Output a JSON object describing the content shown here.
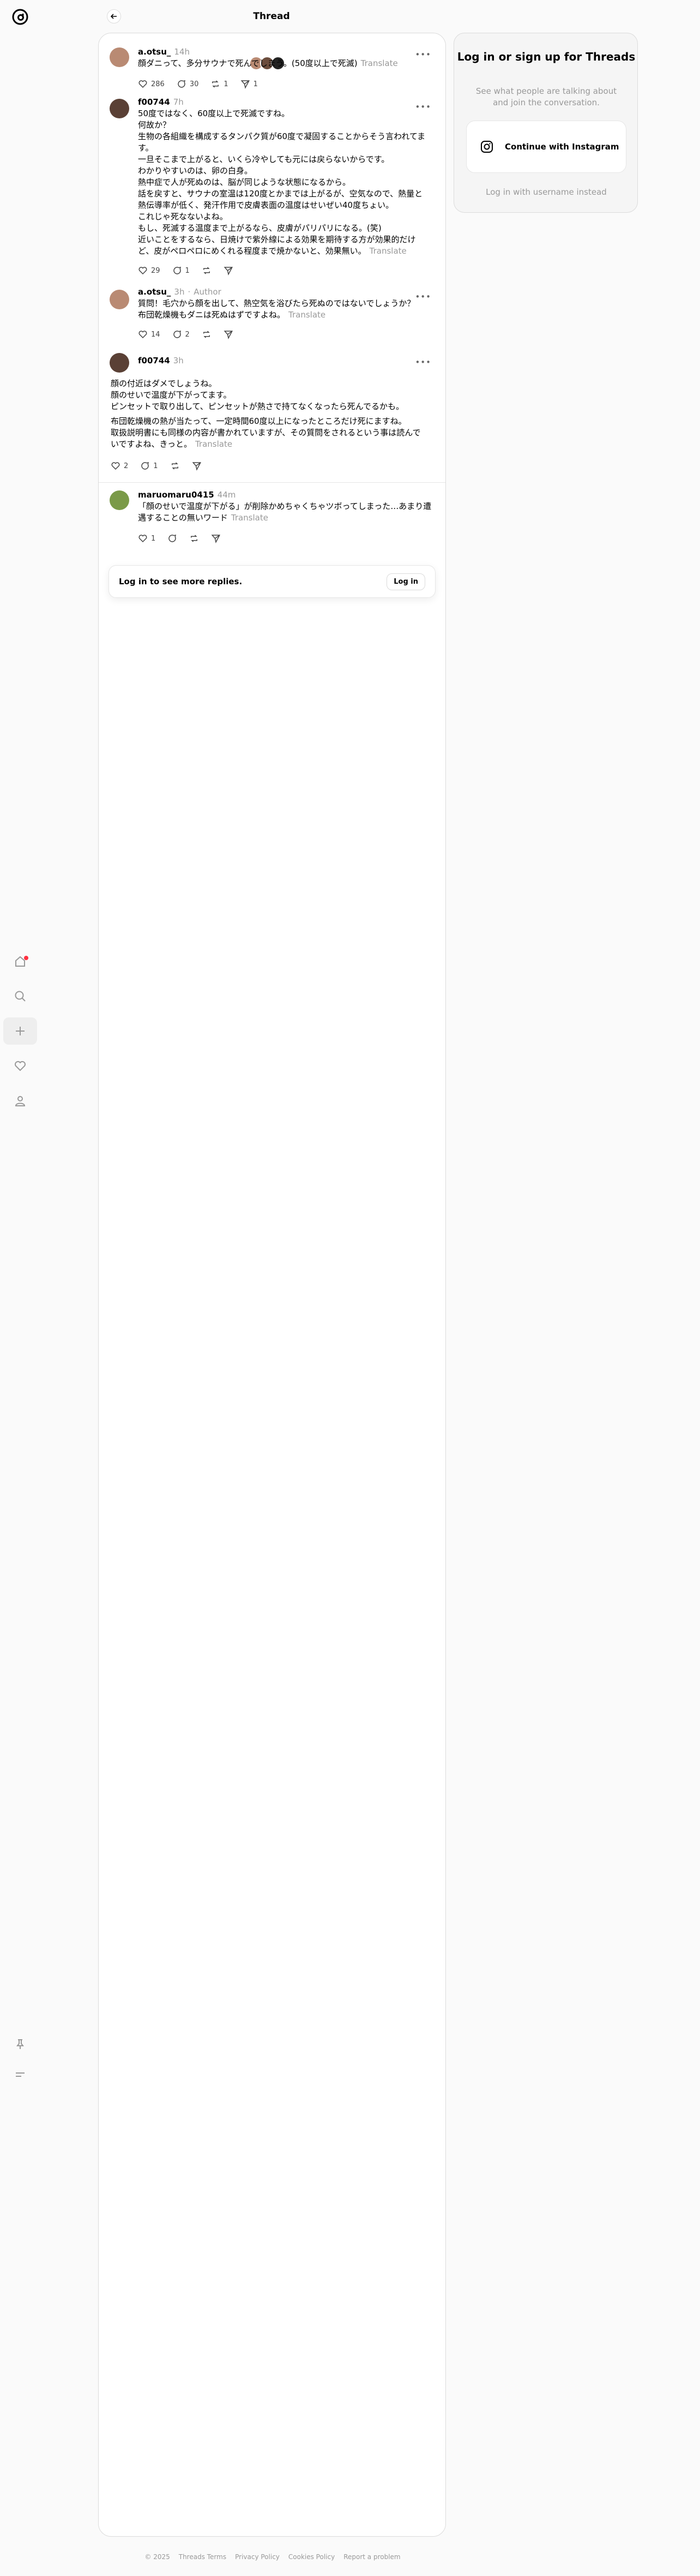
{
  "header": {
    "title": "Thread"
  },
  "posts": [
    {
      "username": "a.otsu_",
      "time": "14h",
      "text": "顔ダニって、多分サウナで死んでしまう。(50度以上で死滅)",
      "translate": "Translate",
      "likes": "286",
      "replies": "30",
      "reposts": "1",
      "shares": "1"
    },
    {
      "username": "f00744",
      "time": "7h",
      "lines": [
        "50度ではなく、60度以上で死滅ですね。",
        "何故か？",
        "生物の各組織を構成するタンパク質が60度で凝固することからそう言われてます。",
        "一旦そこまで上がると、いくら冷やしても元には戻らないからです。",
        "わかりやすいのは、卵の白身。",
        "熱中症で人が死ぬのは、脳が同じような状態になるから。",
        "話を戻すと、サウナの室温は120度とかまでは上がるが、空気なので、熱量と熱伝導率が低く、発汗作用で皮膚表面の温度はせいぜい40度ちょい。",
        "これじゃ死なないよね。",
        "もし、死滅する温度まで上がるなら、皮膚がパリパリになる。(笑)",
        "近いことをするなら、日焼けで紫外線による効果を期待する方が効果的だけど、皮がペロペロにめくれる程度まで焼かないと、効果無い。"
      ],
      "translate": "Translate",
      "likes": "29",
      "replies": "1"
    },
    {
      "username": "a.otsu_",
      "time": "3h",
      "author": "Author",
      "lines": [
        "質問！毛穴から顔を出して、熱空気を浴びたら死ぬのではないでしょうか？",
        "布団乾燥機もダニは死ぬはずですよね。"
      ],
      "translate": "Translate",
      "likes": "14",
      "replies": "2"
    },
    {
      "username": "f00744",
      "time": "3h",
      "para1": [
        "顔の付近はダメでしょうね。",
        "顔のせいで温度が下がってます。",
        "ピンセットで取り出して、ピンセットが熱さで持てなくなったら死んでるかも。"
      ],
      "para2": [
        "布団乾燥機の熱が当たって、一定時間60度以上になったところだけ死にますね。",
        "取扱説明書にも同様の内容が書かれていますが、その質問をされるという事は読んでいですよね、きっと。"
      ],
      "translate": "Translate",
      "likes": "2",
      "replies": "1"
    },
    {
      "username": "maruomaru0415",
      "time": "44m",
      "text": "「顔のせいで温度が下がる」が削除かめちゃくちゃツボってしまった…あまり遭遇することの無いワード",
      "translate": "Translate",
      "likes": "1"
    }
  ],
  "login_banner": {
    "text": "Log in to see more replies.",
    "button": "Log in"
  },
  "right_panel": {
    "title": "Log in or sign up for Threads",
    "subtitle": "See what people are talking about and join the conversation.",
    "instagram_button": "Continue with Instagram",
    "alt_login": "Log in with username instead"
  },
  "footer": [
    "© 2025",
    "Threads Terms",
    "Privacy Policy",
    "Cookies Policy",
    "Report a problem"
  ],
  "colors": {
    "notification_dot": "#ff3040",
    "muted": "#999999"
  }
}
